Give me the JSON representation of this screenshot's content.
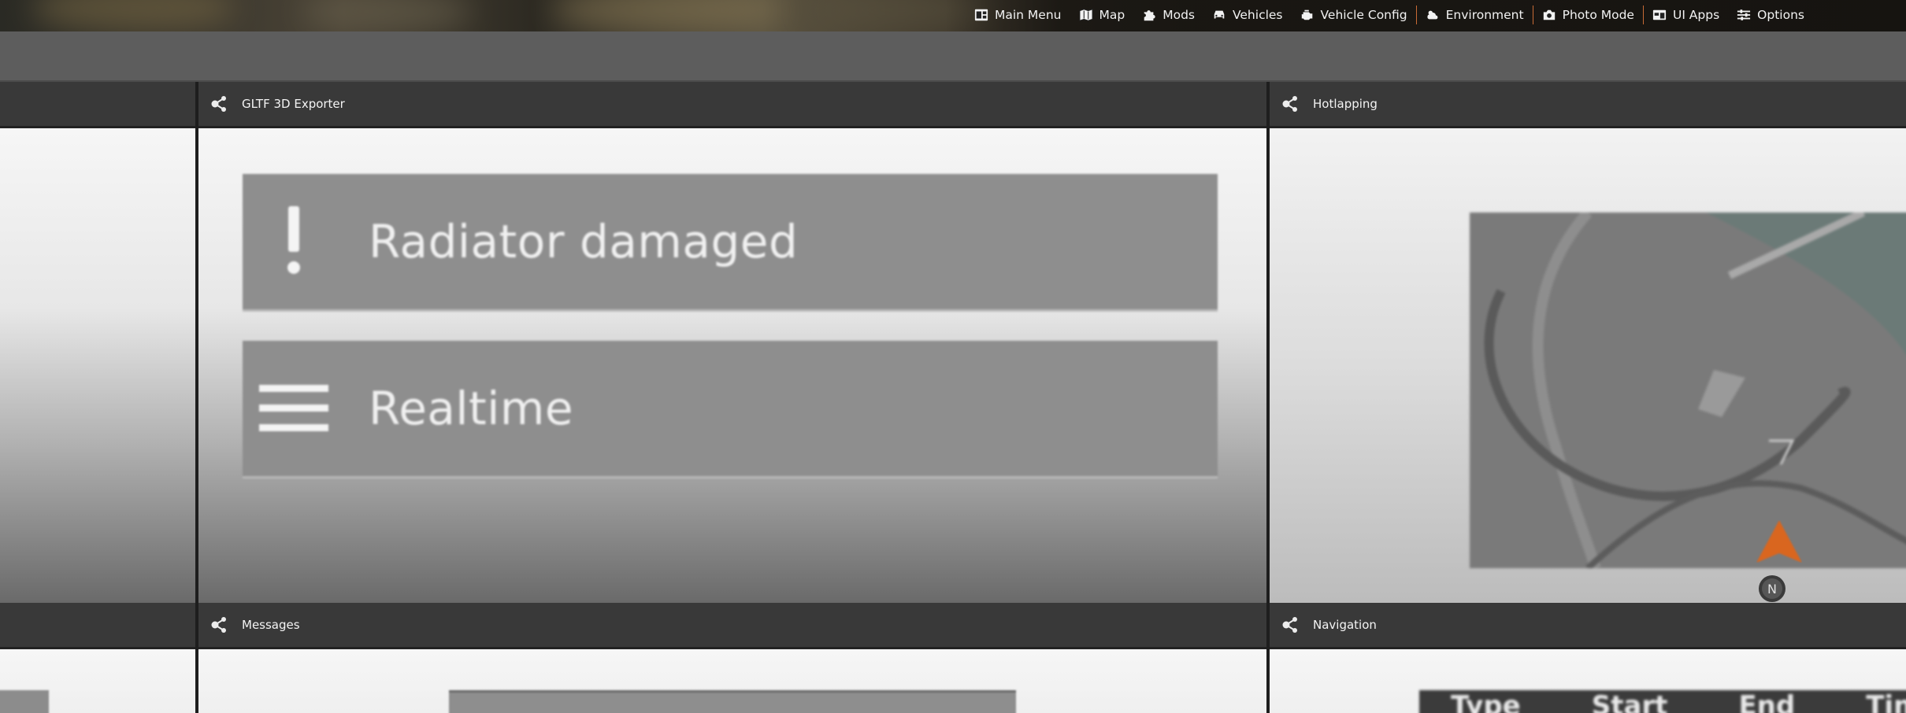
{
  "menubar": {
    "items": [
      {
        "label": "Main Menu",
        "icon": "main-menu-icon"
      },
      {
        "label": "Map",
        "icon": "map-icon"
      },
      {
        "label": "Mods",
        "icon": "puzzle-icon"
      },
      {
        "label": "Vehicles",
        "icon": "car-icon"
      },
      {
        "label": "Vehicle Config",
        "icon": "engine-icon"
      },
      {
        "label": "Environment",
        "icon": "weather-icon"
      },
      {
        "label": "Photo Mode",
        "icon": "camera-icon"
      },
      {
        "label": "UI Apps",
        "icon": "ui-apps-icon"
      },
      {
        "label": "Options",
        "icon": "sliders-icon"
      }
    ],
    "separator_color": "#c86b35"
  },
  "panels": {
    "gltf": {
      "title": "GLTF 3D Exporter",
      "messages": [
        {
          "text": "Radiator damaged",
          "icon": "exclamation-icon"
        },
        {
          "text": "Realtime",
          "icon": "hamburger-icon"
        }
      ]
    },
    "hotlapping": {
      "title": "Hotlapping"
    },
    "messages": {
      "title": "Messages"
    },
    "navigation": {
      "title": "Navigation"
    }
  },
  "navigation_table": {
    "columns": [
      "Type",
      "Start",
      "End",
      "Tim"
    ]
  },
  "colors": {
    "header_bg": "#393939",
    "accent": "#e06a1b"
  }
}
